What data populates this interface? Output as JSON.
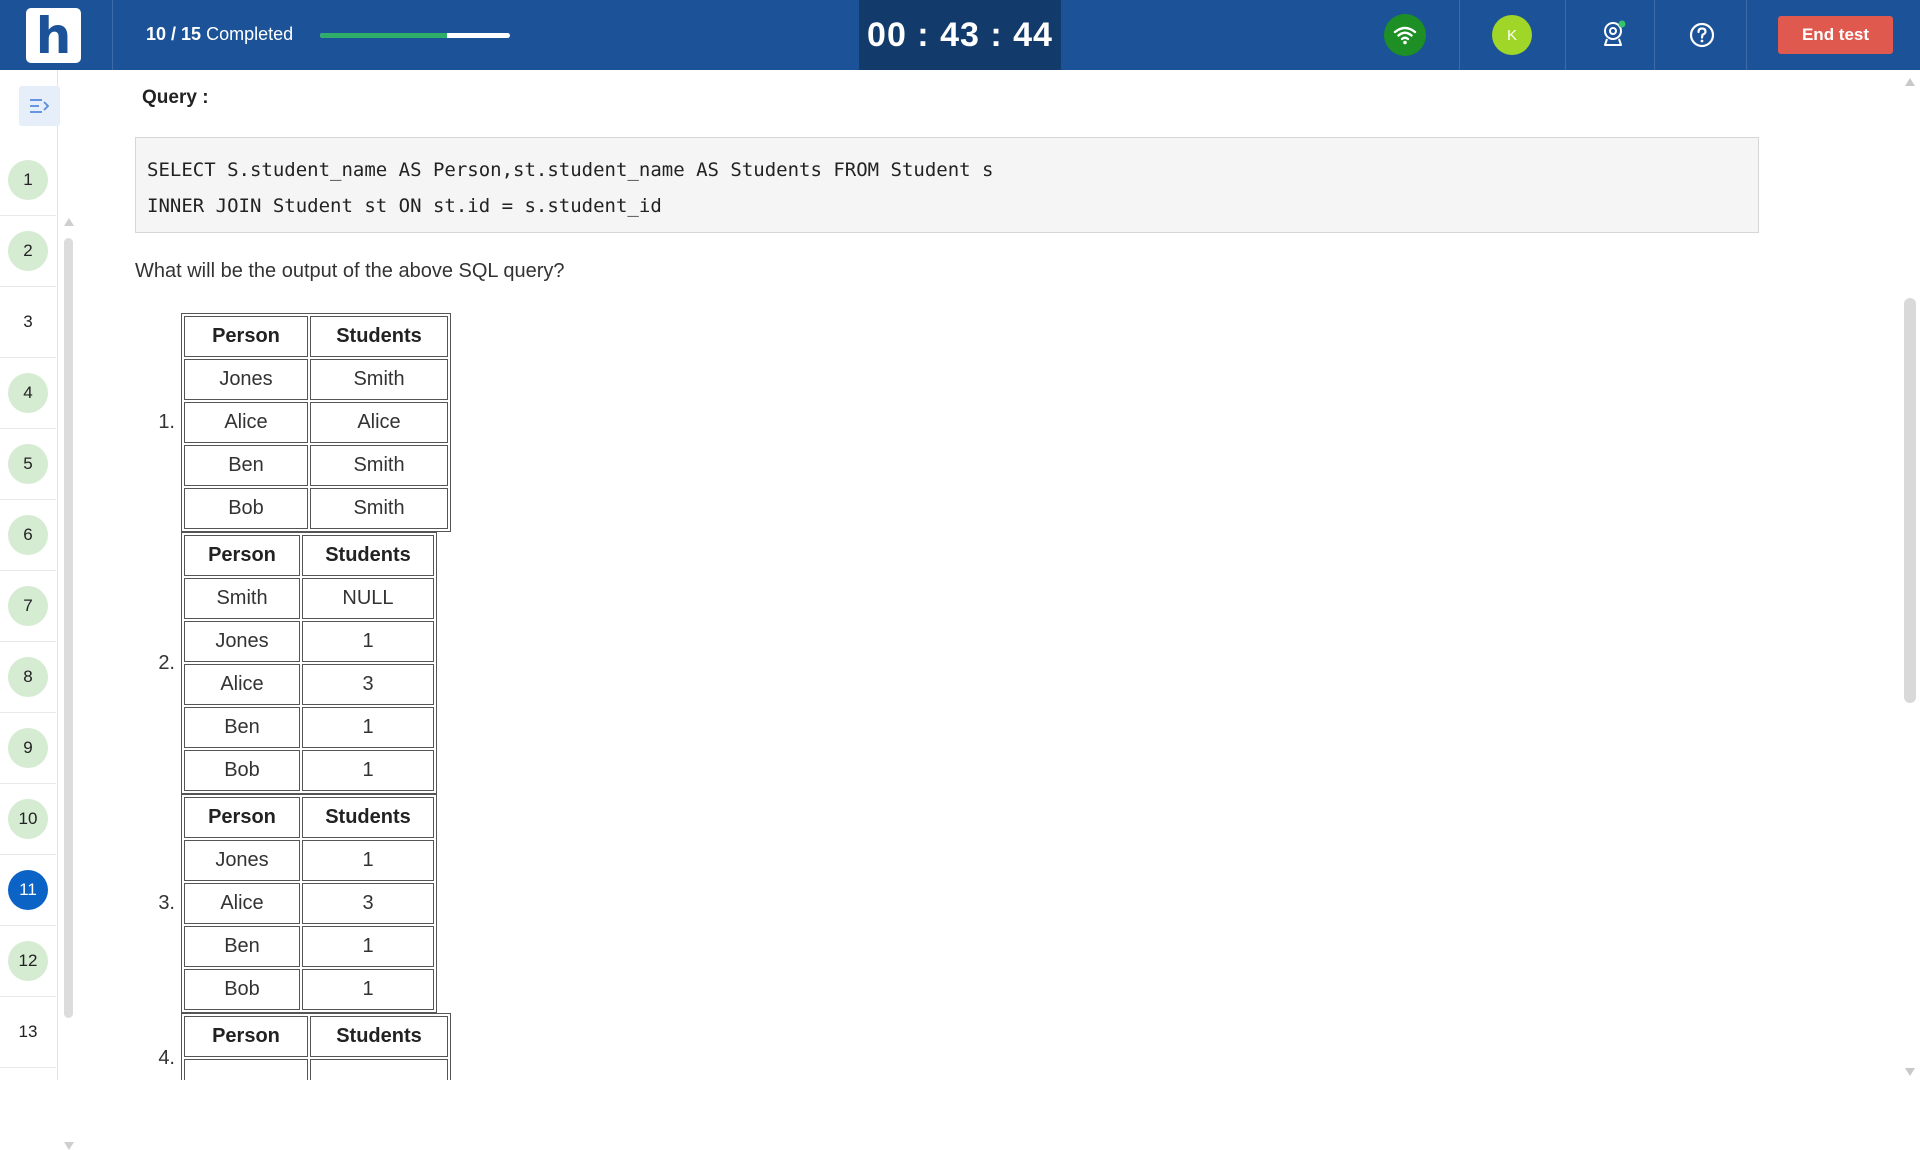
{
  "header": {
    "logo_letter": "h",
    "progress_done": "10",
    "progress_total": "15",
    "progress_suffix": " Completed",
    "progress_fraction": 0.67,
    "timer": "00 : 43 : 44",
    "avatar_initial": "K",
    "end_test_label": "End test",
    "colors": {
      "bar": "#1c5297",
      "timer_bg": "#123a6b",
      "end_button": "#e0594f",
      "wifi": "#1d8f24",
      "avatar": "#9fd628"
    },
    "icons": [
      "wifi-icon",
      "webcam-icon",
      "help-icon"
    ]
  },
  "sidebar": {
    "toggle_icon": "sidebar-toggle-icon",
    "questions": [
      {
        "n": "1",
        "state": "answered"
      },
      {
        "n": "2",
        "state": "answered"
      },
      {
        "n": "3",
        "state": "unanswered"
      },
      {
        "n": "4",
        "state": "answered"
      },
      {
        "n": "5",
        "state": "answered"
      },
      {
        "n": "6",
        "state": "answered"
      },
      {
        "n": "7",
        "state": "answered"
      },
      {
        "n": "8",
        "state": "answered"
      },
      {
        "n": "9",
        "state": "answered"
      },
      {
        "n": "10",
        "state": "answered"
      },
      {
        "n": "11",
        "state": "active"
      },
      {
        "n": "12",
        "state": "answered"
      },
      {
        "n": "13",
        "state": "unanswered"
      }
    ]
  },
  "main": {
    "query_label": "Query :",
    "code_lines": [
      "SELECT S.student_name AS Person,st.student_name AS Students FROM Student s",
      "INNER JOIN Student st ON st.id = s.student_id"
    ],
    "question": "What will be the output of the above SQL query?",
    "options": [
      {
        "label": "1.",
        "headers": [
          "Person",
          "Students"
        ],
        "rows": [
          [
            "Jones",
            "Smith"
          ],
          [
            "Alice",
            "Alice"
          ],
          [
            "Ben",
            "Smith"
          ],
          [
            "Bob",
            "Smith"
          ]
        ]
      },
      {
        "label": "2.",
        "headers": [
          "Person",
          "Students"
        ],
        "rows": [
          [
            "Smith",
            "NULL"
          ],
          [
            "Jones",
            "1"
          ],
          [
            "Alice",
            "3"
          ],
          [
            "Ben",
            "1"
          ],
          [
            "Bob",
            "1"
          ]
        ]
      },
      {
        "label": "3.",
        "headers": [
          "Person",
          "Students"
        ],
        "rows": [
          [
            "Jones",
            "1"
          ],
          [
            "Alice",
            "3"
          ],
          [
            "Ben",
            "1"
          ],
          [
            "Bob",
            "1"
          ]
        ]
      },
      {
        "label": "4.",
        "headers": [
          "Person",
          "Students"
        ],
        "rows": []
      }
    ]
  }
}
